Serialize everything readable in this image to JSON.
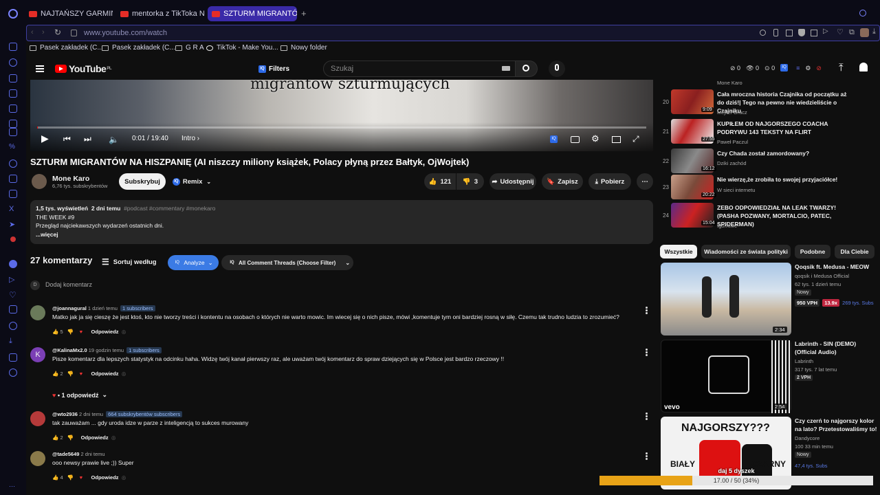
{
  "browser": {
    "tabs": [
      {
        "label": "NAJTAŃSZY GARMIN w pr"
      },
      {
        "label": "mentorka z TikToka NISZC"
      },
      {
        "label": "SZTURM MIGRANTÓW NA"
      }
    ],
    "url": "www.youtube.com/watch",
    "bookmarks": [
      "Pasek zakładek (C...",
      "Pasek zakładek (C...",
      "G R A",
      "TikTok - Make You...",
      "Nowy folder"
    ]
  },
  "header": {
    "logo": "YouTube",
    "logo_region": "PL",
    "filters_label": "Filters",
    "search_placeholder": "Szukaj",
    "stats": [
      "0",
      "0",
      "0"
    ]
  },
  "player": {
    "subtitle": "migrantów szturmujących",
    "time": "0:01 / 19:40",
    "chapter": "Intro",
    "progress": 0.001
  },
  "video": {
    "title": "SZTURM MIGRANTÓW NA HISZPANIĘ (AI niszczy miliony książek, Polacy płyną przez Bałtyk, OjWojtek)",
    "channel": "Mone Karo",
    "subscribers": "6,76 tys. subskrybentów",
    "subscribe_label": "Subskrybuj",
    "remix_label": "Remix",
    "likes": "121",
    "dislikes": "3",
    "share_label": "Udostępnij",
    "save_label": "Zapisz",
    "download_label": "Pobierz"
  },
  "description": {
    "views": "1,5 tys. wyświetleń",
    "date": "2 dni temu",
    "tags": "#podcast #commentary #monekaro",
    "line1": "THE WEEK #9",
    "line2": "Przegląd najciekawszych wydarzeń ostatnich dni.",
    "more": "...więcej"
  },
  "comments_header": {
    "count": "27 komentarzy",
    "sort_label": "Sortuj według",
    "analyze_label": "Analyze",
    "threads_label": "All Comment Threads (Choose Filter)",
    "add_avatar": "D",
    "add_placeholder": "Dodaj komentarz"
  },
  "comments": [
    {
      "author": "@joannagural",
      "time": "1 dzień temu",
      "subs": "1 subscribers",
      "text": "Matko jak ja się cieszę  że jest ktoś, kto nie tworzy treści i kontentu na osobach o których nie warto mowic. Im wiecej się o nich  pisze, mówi ,komentuje tym oni bardziej rosną w siłę. Czemu tak trudno ludzia  to zrozumieć?",
      "likes": "5",
      "reply": "Odpowiedz"
    },
    {
      "author": "@KalinaMx2.0",
      "time": "19 godzin temu",
      "subs": "1 subscribers",
      "avatar_letter": "K",
      "text": "Pisze komentarz dla lepszych statystyk na odcinku haha. Widzę twój kanał pierwszy raz, ale uważam twój komentarz do spraw dziejących się w Polsce jest bardzo rzeczowy !!",
      "likes": "2",
      "reply": "Odpowiedz",
      "replies_toggle": "• 1 odpowiedź"
    },
    {
      "author": "@wto2936",
      "time": "2 dni temu",
      "subs": "664 subskrybentów subscribers",
      "text": "tak zauważam ... gdy uroda idze w parze z inteligencją to sukces murowany",
      "likes": "2",
      "reply": "Odpowiedz"
    },
    {
      "author": "@tade5649",
      "time": "2 dni temu",
      "text": "ooo newsy prawie live ;)) Super",
      "likes": "4",
      "reply": "Odpowiedz"
    }
  ],
  "sidebar_list": [
    {
      "num": "",
      "title": "",
      "channel": "Mone Karo",
      "duration": ""
    },
    {
      "num": "20",
      "title": "Cała mroczna historia Czajnika od początku aż do dziś!| Tego na pewno nie wiedzieliście o Czajniku",
      "channel": "Mejkel Gracz",
      "duration": "9:09"
    },
    {
      "num": "21",
      "title": "KUPIŁEM OD NAJGORSZEGO COACHA PODRYWU 143 TEKSTY NA FLIRT",
      "channel": "Paweł Paczul",
      "duration": "27:55"
    },
    {
      "num": "22",
      "title": "Czy Chada został zamordowany?",
      "channel": "Dziki zachód",
      "duration": "16:12"
    },
    {
      "num": "23",
      "title": "Nie wierzę,że zrobiła to swojej przyjaciółce!",
      "channel": "W sieci internetu",
      "duration": "20:22"
    },
    {
      "num": "24",
      "title": "ZEBO ODPOWIEDZIAŁ NA LEAK TWARZY! (PASHA POZWANY, MORTALCIO, PATEC, SPIDERMAN)",
      "channel": "IgorXlive",
      "duration": "15:04"
    }
  ],
  "chips": [
    "Wszystkie",
    "Wiadomości ze świata polityki",
    "Podobne",
    "Dla Ciebie"
  ],
  "recommendations": [
    {
      "title": "Qoqsik ft. Medusa - MEOW",
      "channel": "qoqsik i Medusa Official",
      "meta": "62 tys.  1 dzień temu",
      "badge": "Nowy",
      "vph": "950 VPH",
      "ratio": "13.9x",
      "subs": "269 tys. Subs",
      "duration": "2:34"
    },
    {
      "title": "Labrinth - SIN (DEMO) (Official Audio)",
      "channel": "Labrinth",
      "meta": "317 tys.  7 lat temu",
      "badge": "2 VPH",
      "duration": "2:54",
      "brand": "vevo"
    },
    {
      "title": "Czy czerń to najgorszy kolor na lato? Przetestowaliśmy to!",
      "channel": "Dandycore",
      "meta": "100  33 min temu",
      "badge": "Nowy",
      "subs": "47,4 tys. Subs",
      "thumb_title": "NAJGORSZY???",
      "thumb_left": "BIAŁY",
      "thumb_right": "CZARNY"
    }
  ],
  "timer": {
    "label": "daj 5 dyszek",
    "value": "17.00 / 50 (34%)",
    "fraction": 0.34
  }
}
